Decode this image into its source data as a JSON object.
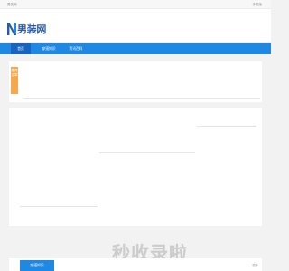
{
  "topbar": {
    "site_name": "男装网",
    "login_label": "手机版"
  },
  "header": {
    "logo_text": "男装网",
    "logo_colors": {
      "primary": "#2a5aa8",
      "accent": "#1e88e5"
    }
  },
  "nav": {
    "items": [
      {
        "label": "首页",
        "active": true
      },
      {
        "label": "穿搭知识",
        "active": false
      },
      {
        "label": "资讯百科",
        "active": false
      }
    ],
    "color": "#1e88e5"
  },
  "sidebar_tag": {
    "label": "推荐文章"
  },
  "watermark": {
    "text": "秒收录啦"
  },
  "footer": {
    "tab_label": "穿搭知识",
    "more_label": "更多"
  }
}
